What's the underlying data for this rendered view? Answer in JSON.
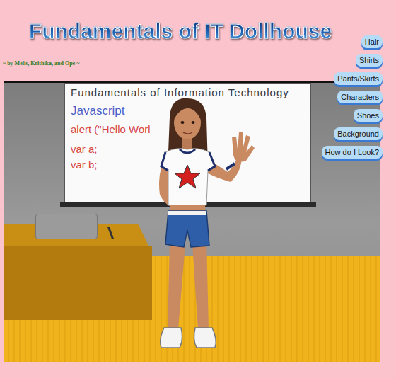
{
  "title": "Fundamentals of IT Dollhouse",
  "subtitle": "~ by Melis, Krithika, and Ope ~",
  "menu": [
    "Hair",
    "Shirts",
    "Pants/Skirts",
    "Characters",
    "Shoes",
    "Background",
    "How do I Look?"
  ],
  "scene": {
    "whiteboard": [
      {
        "text": "Fundamentals of Information Technology",
        "color": "#3a3a3a"
      },
      {
        "text": "Javascript",
        "color": "#4a5fc7"
      },
      {
        "text": "alert (\"Hello Worl",
        "color": "#d8473f"
      },
      {
        "text": "var a;",
        "color": "#d8473f"
      },
      {
        "text": "var b;",
        "color": "#d8473f"
      }
    ]
  }
}
